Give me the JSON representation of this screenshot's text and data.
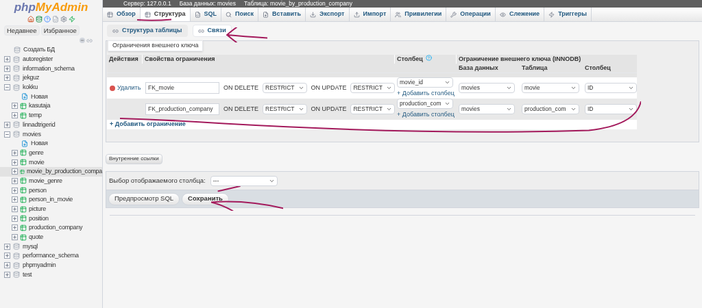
{
  "sidebar": {
    "logo": {
      "part_1": "php",
      "part_2": "MyAdmin"
    },
    "tabs": [
      {
        "label": "Недавнее",
        "selected": false
      },
      {
        "label": "Избранное",
        "selected": false
      }
    ],
    "tree": [
      {
        "kind": "create",
        "label": "Создать БД"
      },
      {
        "kind": "db",
        "label": "autoregister",
        "expanded": false
      },
      {
        "kind": "db",
        "label": "information_schema",
        "expanded": false
      },
      {
        "kind": "db",
        "label": "jekguz",
        "expanded": false
      },
      {
        "kind": "db",
        "label": "kokku",
        "expanded": true,
        "children": [
          {
            "kind": "new",
            "label": "Новая"
          },
          {
            "kind": "table",
            "label": "kasutaja",
            "selected": false
          },
          {
            "kind": "table",
            "label": "temp",
            "selected": false
          }
        ]
      },
      {
        "kind": "db",
        "label": "linnadtrigerid",
        "expanded": false
      },
      {
        "kind": "db",
        "label": "movies",
        "expanded": true,
        "children": [
          {
            "kind": "new",
            "label": "Новая"
          },
          {
            "kind": "table",
            "label": "genre",
            "selected": false
          },
          {
            "kind": "table",
            "label": "movie",
            "selected": false
          },
          {
            "kind": "table",
            "label": "movie_by_production_compa",
            "selected": true
          },
          {
            "kind": "table",
            "label": "movie_genre",
            "selected": false
          },
          {
            "kind": "table",
            "label": "person",
            "selected": false
          },
          {
            "kind": "table",
            "label": "person_in_movie",
            "selected": false
          },
          {
            "kind": "table",
            "label": "picture",
            "selected": false
          },
          {
            "kind": "table",
            "label": "position",
            "selected": false
          },
          {
            "kind": "table",
            "label": "production_company",
            "selected": false
          },
          {
            "kind": "table",
            "label": "quote",
            "selected": false
          }
        ]
      },
      {
        "kind": "db",
        "label": "mysql",
        "expanded": false
      },
      {
        "kind": "db",
        "label": "performance_schema",
        "expanded": false
      },
      {
        "kind": "db",
        "label": "phpmyadmin",
        "expanded": false
      },
      {
        "kind": "db",
        "label": "test",
        "expanded": false
      }
    ]
  },
  "breadcrumbs": [
    "Сервер: 127.0.0.1",
    "База данных: movies",
    "Таблица: movie_by_production_company"
  ],
  "tabs": [
    {
      "label": "Обзор",
      "selected": false
    },
    {
      "label": "Структура",
      "selected": true
    },
    {
      "label": "SQL",
      "selected": false
    },
    {
      "label": "Поиск",
      "selected": false
    },
    {
      "label": "Вставить",
      "selected": false
    },
    {
      "label": "Экспорт",
      "selected": false
    },
    {
      "label": "Импорт",
      "selected": false
    },
    {
      "label": "Привилегии",
      "selected": false
    },
    {
      "label": "Операции",
      "selected": false
    },
    {
      "label": "Слежение",
      "selected": false
    },
    {
      "label": "Триггеры",
      "selected": false
    }
  ],
  "subtabs": [
    {
      "label": "Структура таблицы",
      "selected": false
    },
    {
      "label": "Связи",
      "selected": true
    }
  ],
  "fieldset_legend": "Ограничения внешнего ключа",
  "table": {
    "columns": [
      "Действия",
      "Свойства ограничения",
      "Столбец",
      "Ограничение внешнего ключа (INNODB)"
    ],
    "sub_columns": [
      "База данных",
      "Таблица",
      "Столбец"
    ],
    "rows": [
      {
        "delete_label": "Удалить",
        "name": "FK_movie",
        "on_delete_label": "ON DELETE",
        "on_delete": "RESTRICT",
        "on_update_label": "ON UPDATE",
        "on_update": "RESTRICT",
        "column": "movie_id",
        "add_column": "+ Добавить столбец",
        "ref_db": "movies",
        "ref_table": "movie",
        "ref_column": "ID"
      },
      {
        "name": "FK_production_company",
        "on_delete_label": "ON DELETE",
        "on_delete": "RESTRICT",
        "on_update_label": "ON UPDATE",
        "on_update": "RESTRICT",
        "column": "production_com",
        "add_column": "+ Добавить столбец",
        "ref_db": "movies",
        "ref_table": "production_com",
        "ref_column": "ID"
      }
    ],
    "add_constraint": "+ Добавить ограничение"
  },
  "internal_links_button": "Внутренние ссылки",
  "display_column": {
    "label": "Выбор отображаемого столбца:",
    "value": "---"
  },
  "buttons": [
    "Предпросмотр SQL",
    "Сохранить"
  ]
}
